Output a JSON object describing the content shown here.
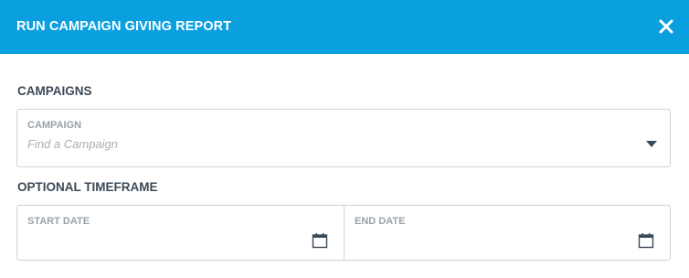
{
  "header": {
    "title": "RUN CAMPAIGN GIVING REPORT",
    "close_icon": "close-icon",
    "background_color": "#0aa0e0"
  },
  "campaigns": {
    "section_label": "CAMPAIGNS",
    "field": {
      "label": "CAMPAIGN",
      "placeholder": "Find a Campaign",
      "value": "",
      "icon": "chevron-down-icon"
    }
  },
  "timeframe": {
    "section_label": "OPTIONAL TIMEFRAME",
    "start_date": {
      "label": "START DATE",
      "value": "",
      "icon": "calendar-icon"
    },
    "end_date": {
      "label": "END DATE",
      "value": "",
      "icon": "calendar-icon"
    }
  }
}
